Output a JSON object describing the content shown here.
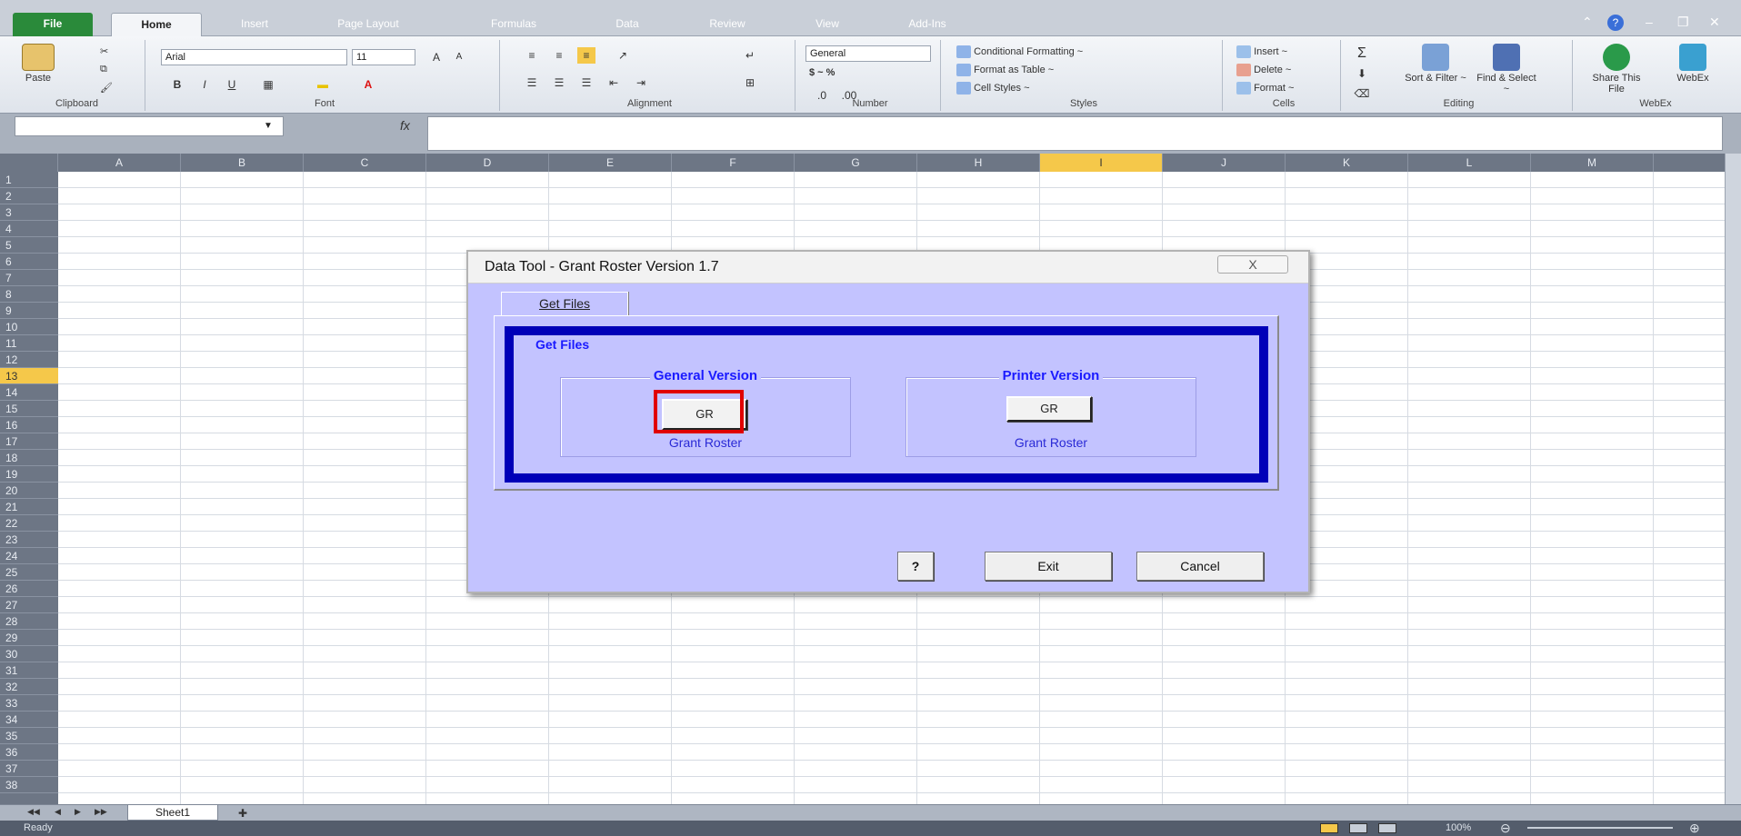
{
  "ribbon": {
    "tabs": [
      "File",
      "Home",
      "Insert",
      "Page Layout",
      "Formulas",
      "Data",
      "Review",
      "View",
      "Add-Ins"
    ],
    "clipboard": {
      "paste": "Paste",
      "label": "Clipboard"
    },
    "font": {
      "name": "Arial",
      "size": "11",
      "label": "Font"
    },
    "alignment": {
      "label": "Alignment"
    },
    "number": {
      "format": "General",
      "currency": "$ ~ %",
      "label": "Number"
    },
    "styles": {
      "conditional": "Conditional Formatting ~",
      "format_table": "Format as Table ~",
      "cell_styles": "Cell Styles ~",
      "label": "Styles"
    },
    "cells": {
      "insert": "Insert ~",
      "delete": "Delete ~",
      "format": "Format ~",
      "label": "Cells"
    },
    "editing": {
      "sort": "Sort & Filter ~",
      "find": "Find & Select ~",
      "label": "Editing"
    },
    "webex": {
      "share": "Share This File",
      "webex": "WebEx",
      "label": "WebEx"
    }
  },
  "formula_bar": {
    "fx": "fx"
  },
  "columns": [
    "A",
    "B",
    "C",
    "D",
    "E",
    "F",
    "G",
    "H",
    "I",
    "J",
    "K",
    "L",
    "M"
  ],
  "selected_column": "I",
  "selected_row": 13,
  "row_count": 38,
  "dialog": {
    "title": "Data Tool - Grant Roster Version 1.7",
    "close": "X",
    "tab": "Get Files",
    "frame_title": "Get Files",
    "general": {
      "title": "General Version",
      "button": "GR",
      "caption": "Grant Roster"
    },
    "printer": {
      "title": "Printer Version",
      "button": "GR",
      "caption": "Grant Roster"
    },
    "help_icon": "?",
    "exit": "Exit",
    "cancel": "Cancel"
  },
  "sheet_tab": "Sheet1",
  "status": {
    "ready": "Ready",
    "zoom": "100%"
  }
}
